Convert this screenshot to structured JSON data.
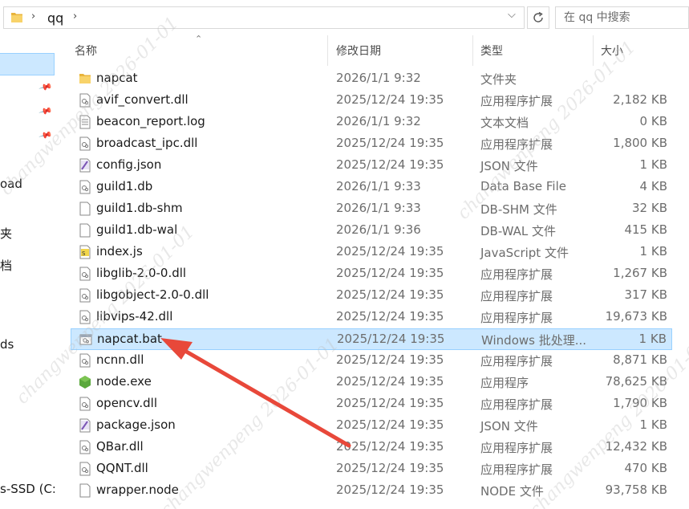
{
  "address": {
    "crumbs": [
      "qq"
    ],
    "sep_glyph": "›",
    "dropdown_glyph": "⌵"
  },
  "search": {
    "placeholder": "在 qq 中搜索"
  },
  "nav": {
    "partial_labels": [
      {
        "text": "oad",
        "top": 0
      },
      {
        "text": "夹",
        "top": 0
      },
      {
        "text": "档",
        "top": 0
      },
      {
        "text": "ds",
        "top": 0
      },
      {
        "text": "s-SSD (C:)",
        "top": 0
      }
    ]
  },
  "columns": {
    "name": "名称",
    "date": "修改日期",
    "type": "类型",
    "size": "大小"
  },
  "files": [
    {
      "name": "napcat",
      "date": "2026/1/1 9:32",
      "type": "文件夹",
      "size": "",
      "icon": "folder-icon"
    },
    {
      "name": "avif_convert.dll",
      "date": "2025/12/24 19:35",
      "type": "应用程序扩展",
      "size": "2,182 KB",
      "icon": "dll-file-icon"
    },
    {
      "name": "beacon_report.log",
      "date": "2026/1/1 9:32",
      "type": "文本文档",
      "size": "0 KB",
      "icon": "text-file-icon"
    },
    {
      "name": "broadcast_ipc.dll",
      "date": "2025/12/24 19:35",
      "type": "应用程序扩展",
      "size": "1,800 KB",
      "icon": "dll-file-icon"
    },
    {
      "name": "config.json",
      "date": "2025/12/24 19:35",
      "type": "JSON 文件",
      "size": "1 KB",
      "icon": "json-file-icon"
    },
    {
      "name": "guild1.db",
      "date": "2026/1/1 9:33",
      "type": "Data Base File",
      "size": "4 KB",
      "icon": "dll-file-icon"
    },
    {
      "name": "guild1.db-shm",
      "date": "2026/1/1 9:33",
      "type": "DB-SHM 文件",
      "size": "32 KB",
      "icon": "blank-file-icon"
    },
    {
      "name": "guild1.db-wal",
      "date": "2026/1/1 9:36",
      "type": "DB-WAL 文件",
      "size": "415 KB",
      "icon": "blank-file-icon"
    },
    {
      "name": "index.js",
      "date": "2025/12/24 19:35",
      "type": "JavaScript 文件",
      "size": "1 KB",
      "icon": "js-file-icon"
    },
    {
      "name": "libglib-2.0-0.dll",
      "date": "2025/12/24 19:35",
      "type": "应用程序扩展",
      "size": "1,267 KB",
      "icon": "dll-file-icon"
    },
    {
      "name": "libgobject-2.0-0.dll",
      "date": "2025/12/24 19:35",
      "type": "应用程序扩展",
      "size": "317 KB",
      "icon": "dll-file-icon"
    },
    {
      "name": "libvips-42.dll",
      "date": "2025/12/24 19:35",
      "type": "应用程序扩展",
      "size": "19,673 KB",
      "icon": "dll-file-icon"
    },
    {
      "name": "napcat.bat",
      "date": "2025/12/24 19:35",
      "type": "Windows 批处理...",
      "size": "1 KB",
      "icon": "bat-file-icon",
      "selected": true
    },
    {
      "name": "ncnn.dll",
      "date": "2025/12/24 19:35",
      "type": "应用程序扩展",
      "size": "8,871 KB",
      "icon": "dll-file-icon"
    },
    {
      "name": "node.exe",
      "date": "2025/12/24 19:35",
      "type": "应用程序",
      "size": "78,625 KB",
      "icon": "node-exe-icon"
    },
    {
      "name": "opencv.dll",
      "date": "2025/12/24 19:35",
      "type": "应用程序扩展",
      "size": "1,790 KB",
      "icon": "dll-file-icon"
    },
    {
      "name": "package.json",
      "date": "2025/12/24 19:35",
      "type": "JSON 文件",
      "size": "1 KB",
      "icon": "json-file-icon"
    },
    {
      "name": "QBar.dll",
      "date": "2025/12/24 19:35",
      "type": "应用程序扩展",
      "size": "12,432 KB",
      "icon": "dll-file-icon"
    },
    {
      "name": "QQNT.dll",
      "date": "2025/12/24 19:35",
      "type": "应用程序扩展",
      "size": "470 KB",
      "icon": "dll-file-icon"
    },
    {
      "name": "wrapper.node",
      "date": "2025/12/24 19:35",
      "type": "NODE 文件",
      "size": "93,758 KB",
      "icon": "blank-file-icon"
    }
  ],
  "watermark": {
    "text": "changwenpeng 2026-01-01"
  },
  "colors": {
    "selection_bg": "#cce8ff",
    "selection_border": "#99d1ff",
    "arrow": "#e8483a"
  }
}
